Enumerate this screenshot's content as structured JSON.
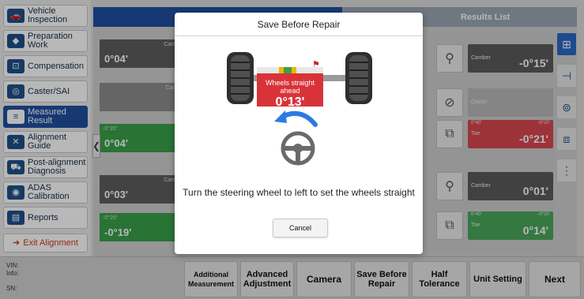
{
  "sidebar": {
    "items": [
      {
        "label": "Vehicle Inspection",
        "icon": "vehicle-inspection-icon",
        "glyph": "🚗"
      },
      {
        "label": "Preparation Work",
        "icon": "preparation-icon",
        "glyph": "◆"
      },
      {
        "label": "Compensation",
        "icon": "compensation-icon",
        "glyph": "⊡"
      },
      {
        "label": "Caster/SAI",
        "icon": "caster-icon",
        "glyph": "◎"
      },
      {
        "label": "Measured Result",
        "icon": "measured-result-icon",
        "glyph": "≡"
      },
      {
        "label": "Alignment Guide",
        "icon": "alignment-guide-icon",
        "glyph": "✕"
      },
      {
        "label": "Post-alignment Diagnosis",
        "icon": "post-alignment-icon",
        "glyph": "⛟"
      },
      {
        "label": "ADAS Calibration",
        "icon": "adas-icon",
        "glyph": "◉"
      },
      {
        "label": "Reports",
        "icon": "reports-icon",
        "glyph": "▤"
      }
    ],
    "exit_label": "Exit Alignment"
  },
  "header": {
    "results_list": "Results List"
  },
  "left_measurements": [
    {
      "value": "0°04'",
      "sub": "Cam"
    },
    {
      "value": "",
      "sub": "Cas"
    },
    {
      "value": "0°04'",
      "sub": ""
    },
    {
      "value": "0°03'",
      "sub": "Cam"
    },
    {
      "value": "-0°19'",
      "sub": ""
    }
  ],
  "left_scales": {
    "minus": "-0°20'",
    "plus": "0"
  },
  "results": {
    "rows": [
      {
        "label": "Camber",
        "value": "-0°15'",
        "scale_left": "",
        "scale_right": ""
      },
      {
        "label": "Caster",
        "value": "",
        "scale_left": "",
        "scale_right": ""
      },
      {
        "label": "Toe",
        "value": "-0°21'",
        "scale_left": "0°40'",
        "scale_right": "-0°20'"
      },
      {
        "label": "Camber",
        "value": "0°01'",
        "scale_left": "",
        "scale_right": ""
      },
      {
        "label": "Toe",
        "value": "0°14'",
        "scale_left": "0°40'",
        "scale_right": "-0°20'"
      }
    ]
  },
  "modal": {
    "title": "Save Before Repair",
    "gauge_label": "Wheels straight ahead",
    "gauge_value": "0°13'",
    "description": "Turn the steering wheel to left to set the wheels straight",
    "cancel_label": "Cancel"
  },
  "bottom": {
    "vin": "VIN:",
    "info": "Info:",
    "sn": "SN:",
    "buttons": [
      {
        "label": "Additional Measurement"
      },
      {
        "label": "Advanced Adjustment"
      },
      {
        "label": "Camera"
      },
      {
        "label": "Save Before Repair"
      },
      {
        "label": "Half Tolerance"
      },
      {
        "label": "Unit Setting"
      },
      {
        "label": "Next"
      }
    ]
  },
  "colors": {
    "primary_blue": "#1f4fa0",
    "red_gauge": "#d9333a",
    "green": "#3aa04a",
    "exit_red": "#d13a1a"
  }
}
